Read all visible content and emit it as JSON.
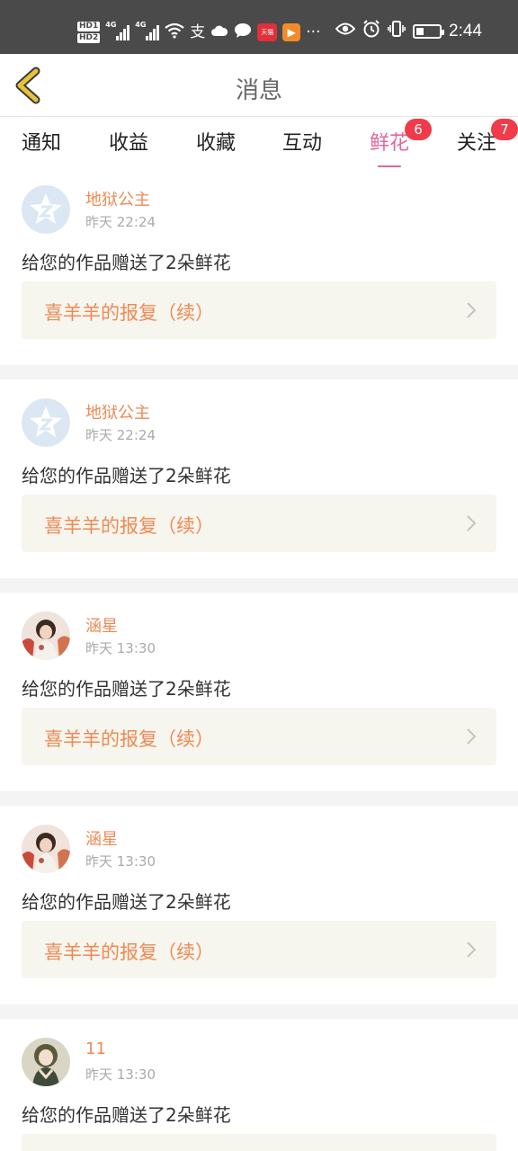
{
  "status_bar": {
    "hd1": "HD1",
    "hd2": "HD2",
    "net1": "4G",
    "net2": "4G",
    "alipay": "支",
    "more": "···",
    "time": "2:44",
    "tmall_label": "天猫"
  },
  "header": {
    "title": "消息"
  },
  "tabs": [
    {
      "label": "通知"
    },
    {
      "label": "收益"
    },
    {
      "label": "收藏"
    },
    {
      "label": "互动"
    },
    {
      "label": "鲜花",
      "badge": "6",
      "active": true
    },
    {
      "label": "关注",
      "badge": "7"
    }
  ],
  "messages": [
    {
      "user": "地狱公主",
      "time": "昨天 22:24",
      "text": "给您的作品赠送了2朵鲜花",
      "work": "喜羊羊的报复（续）"
    },
    {
      "user": "地狱公主",
      "time": "昨天 22:24",
      "text": "给您的作品赠送了2朵鲜花",
      "work": "喜羊羊的报复（续）"
    },
    {
      "user": "涵星",
      "time": "昨天 13:30",
      "text": "给您的作品赠送了2朵鲜花",
      "work": "喜羊羊的报复（续）"
    },
    {
      "user": "涵星",
      "time": "昨天 13:30",
      "text": "给您的作品赠送了2朵鲜花",
      "work": "喜羊羊的报复（续）"
    },
    {
      "user": "11",
      "time": "昨天 13:30",
      "text": "给您的作品赠送了2朵鲜花",
      "work": ""
    }
  ],
  "colors": {
    "accent_pink": "#e0679e",
    "username_orange": "#ee8a55",
    "badge_red": "#ef3b4a",
    "back_arrow": "#e8c23a"
  }
}
